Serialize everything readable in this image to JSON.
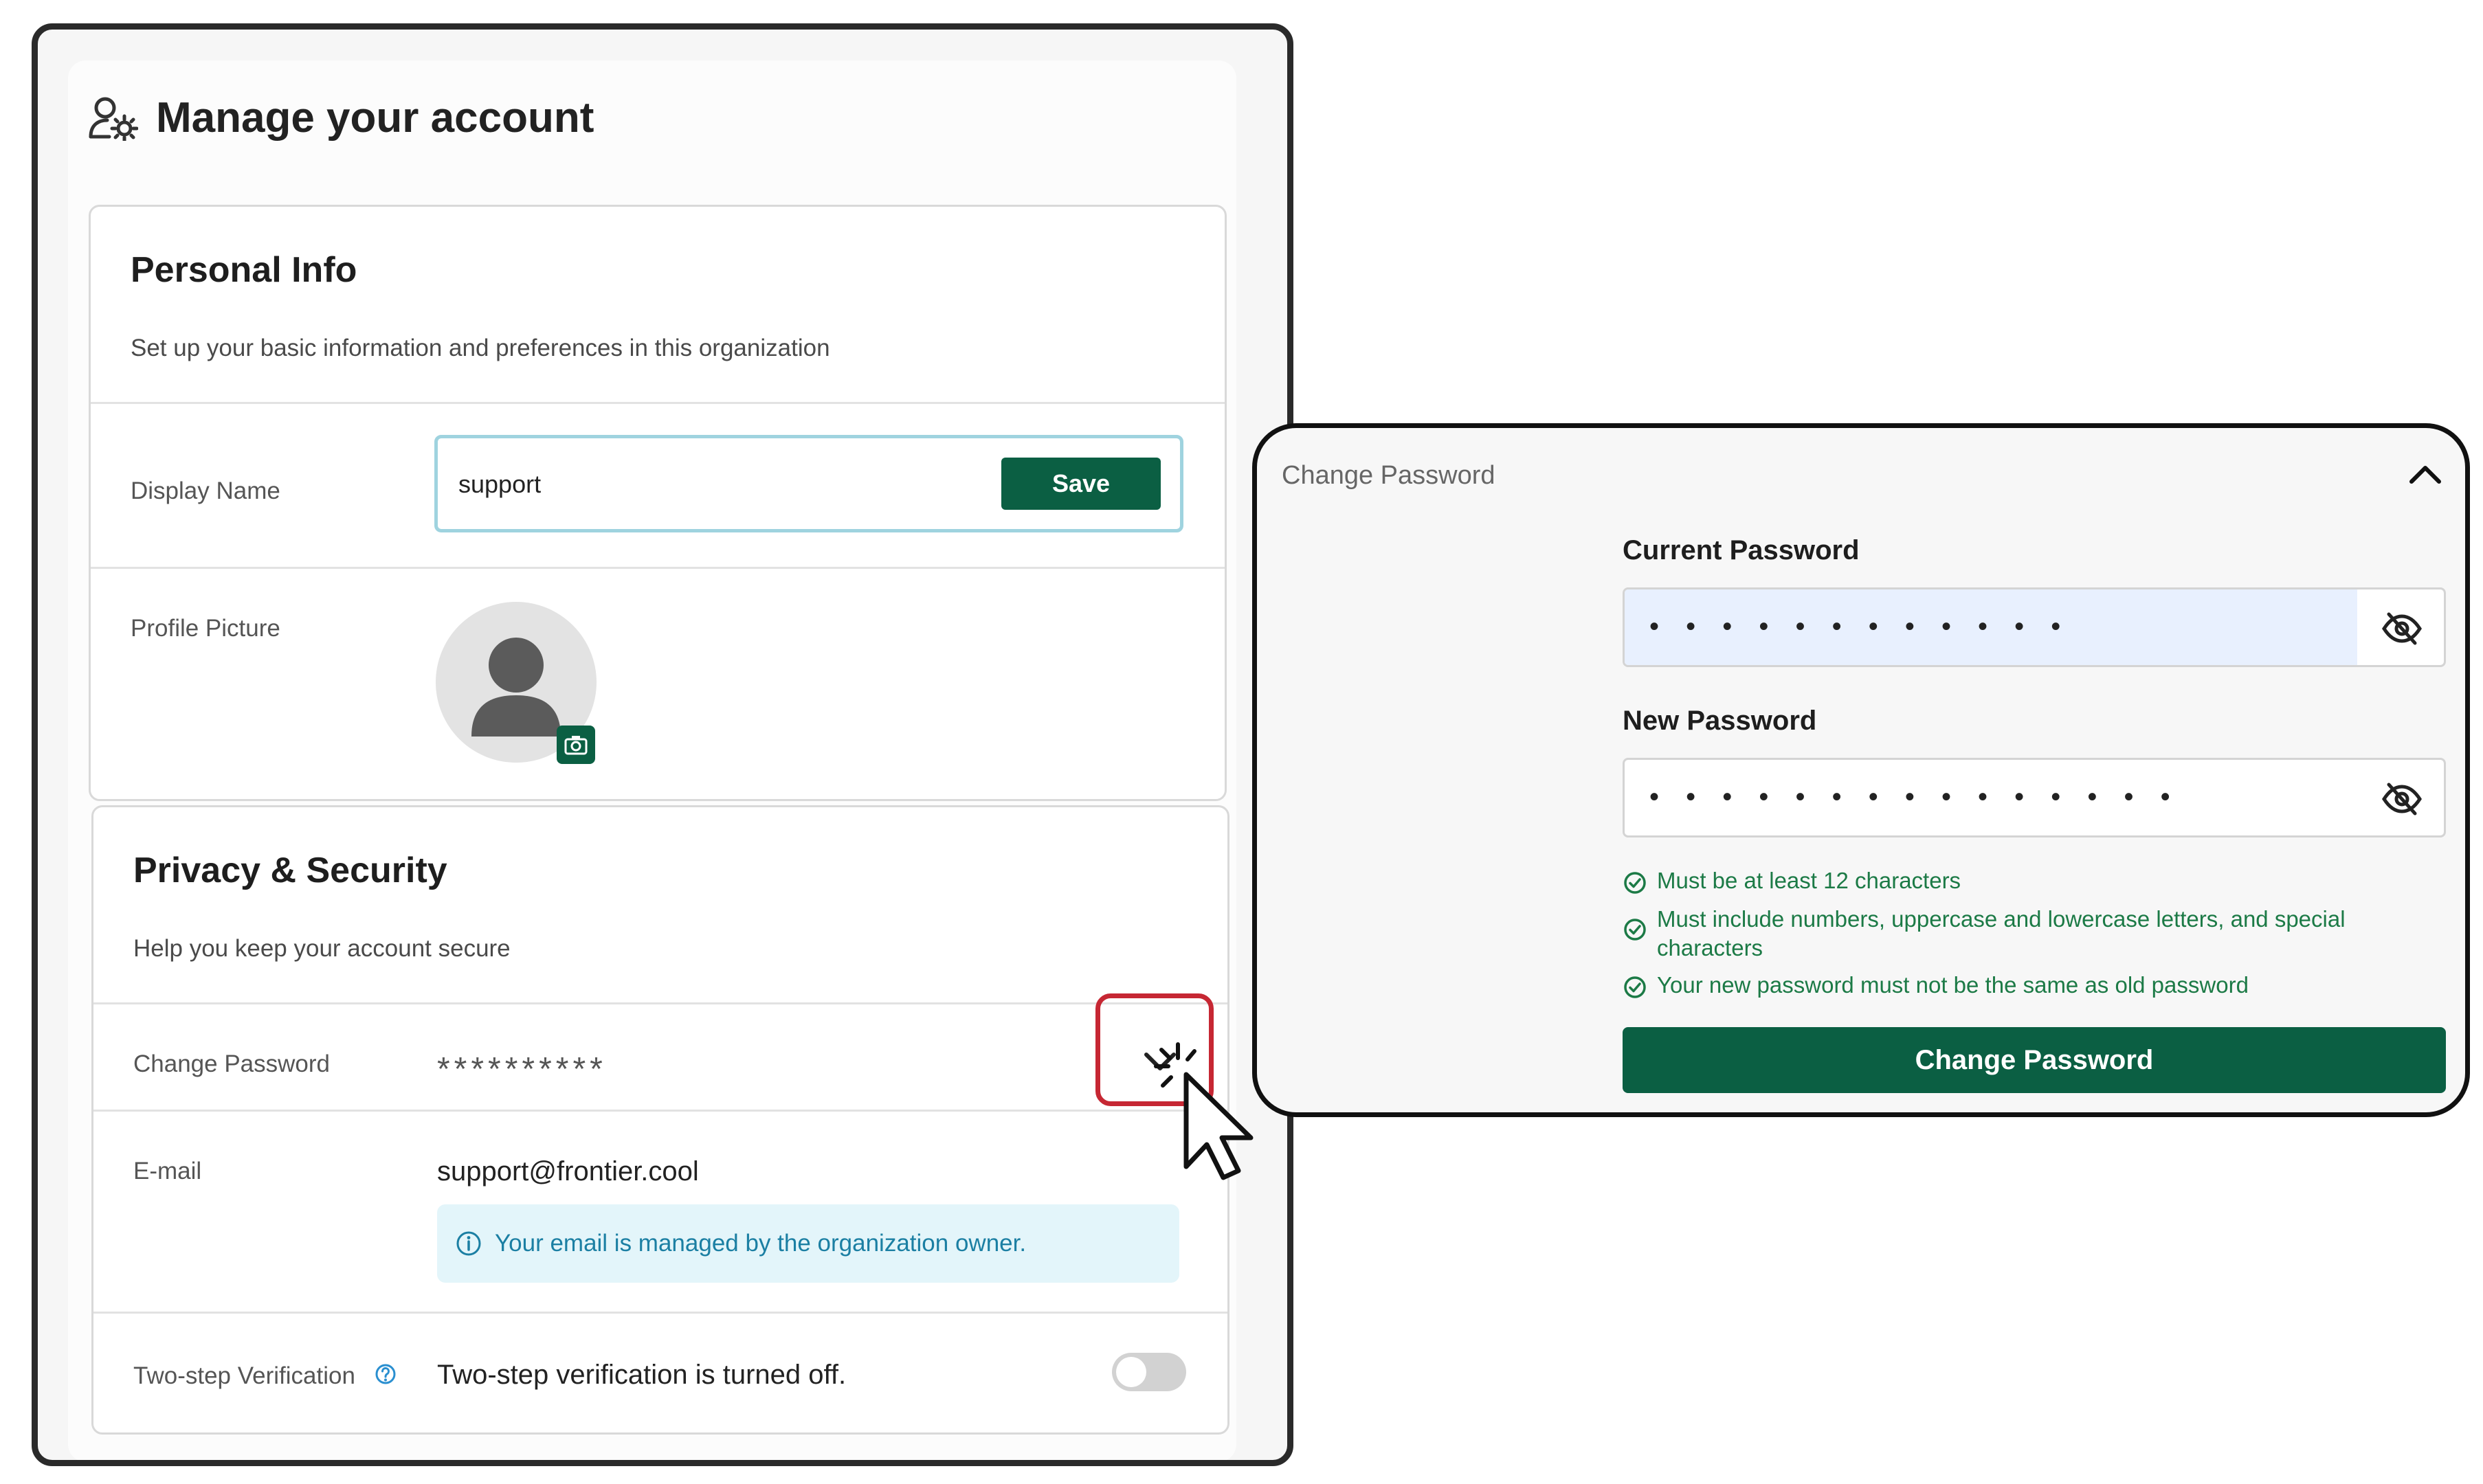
{
  "page": {
    "title": "Manage your account",
    "icon": "user-gear-icon"
  },
  "personal_info": {
    "title": "Personal Info",
    "subtitle": "Set up your basic information and preferences in this organization",
    "display_name_label": "Display Name",
    "display_name_value": "support",
    "save_label": "Save",
    "profile_picture_label": "Profile Picture"
  },
  "privacy": {
    "title": "Privacy & Security",
    "subtitle": "Help you keep your account secure",
    "change_password_label": "Change Password",
    "password_mask": "**********",
    "email_label": "E-mail",
    "email_value": "support@frontier.cool",
    "email_notice": "Your email is managed by the organization owner.",
    "two_step_label": "Two-step Verification",
    "two_step_status": "Two-step verification is turned off.",
    "two_step_enabled": false
  },
  "change_password_panel": {
    "header": "Change Password",
    "current_password_label": "Current Password",
    "current_password_mask": "• • • • • • • • • • • •",
    "new_password_label": "New Password",
    "new_password_mask": "• • • • • • • • • • • • • • •",
    "rules": [
      "Must be at least 12 characters",
      "Must include numbers, uppercase and lowercase letters, and special characters",
      "Your new password must not be the same as old password"
    ],
    "submit_label": "Change Password"
  },
  "colors": {
    "primary": "#0b5f43",
    "highlight": "#c62733",
    "info_text": "#1b7fa3",
    "info_bg": "#e3f5fa",
    "rule_ok": "#1c7a46"
  }
}
